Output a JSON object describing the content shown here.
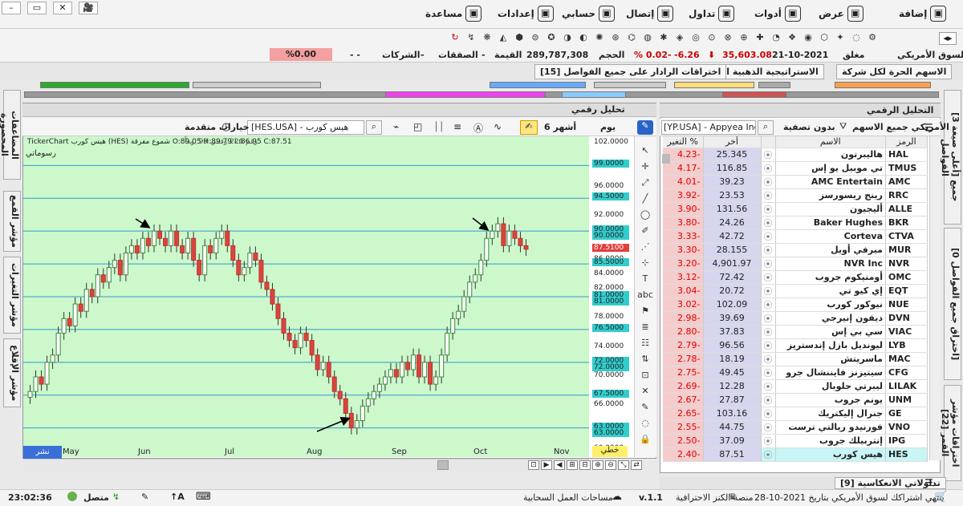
{
  "window": {
    "btns": [
      "–",
      "▭",
      "✕",
      "🎥"
    ]
  },
  "menu": [
    {
      "label": "إضافة",
      "icon": "add-icon",
      "x": 1120
    },
    {
      "label": "عرض",
      "icon": "view-icon",
      "x": 1020
    },
    {
      "label": "أدوات",
      "icon": "tools-icon",
      "x": 940
    },
    {
      "label": "تداول",
      "icon": "trade-icon",
      "x": 858
    },
    {
      "label": "إتصال",
      "icon": "connect-icon",
      "x": 780
    },
    {
      "label": "حسابي",
      "icon": "account-icon",
      "x": 700
    },
    {
      "label": "إعدادات",
      "icon": "settings-icon",
      "x": 620
    },
    {
      "label": "مساعدة",
      "icon": "help-icon",
      "x": 530
    }
  ],
  "index": {
    "market": "السوق الأمريكي",
    "status": "مغلق",
    "date": "21-10-2021",
    "value": "35,603.08",
    "change": "-6.26",
    "pct": "% 0.02-",
    "vol_label": "الحجم",
    "vol": "289,787,308",
    "val_label": "القيمة",
    "val": "-",
    "deals_label": "الصفقات",
    "deals": "-",
    "cos_label": "الشركات",
    "cos": "- -",
    "pct2": "%0.00"
  },
  "tabs1": [
    "الاسهم الحرة لكل شركة",
    "الاستراتيجية الذهبية المميزة [5]",
    "اختراقات الرادار على جميع الفواصل [15]"
  ],
  "chart": {
    "title": "تحليل رقمي",
    "search": "[HES.USA] - هيس كورب",
    "adv": "خيارات متقدمة",
    "period": "6 أشهر",
    "interval": "يوم",
    "info": "TickerChart هيس كورب (HES) شموع مفرقة O:89.05 H:89.79 L:86.95 C:87.51",
    "info2": "رقم 226 رقمي 99 يوماً",
    "draw_label": "رسوماتي",
    "months": [
      "May",
      "Jun",
      "Jul",
      "Aug",
      "Sep",
      "Oct",
      "Nov"
    ],
    "yticks": [
      "102.0000",
      "99.0000",
      "96.0000",
      "94.5000",
      "92.0000",
      "90.0000",
      "90.0000",
      "87.5100",
      "86.0000",
      "85.5000",
      "84.0000",
      "82.0000",
      "81.0000",
      "81.0000",
      "78.0000",
      "76.5000",
      "74.0000",
      "72.0000",
      "72.0000",
      "70.0000",
      "67.5000",
      "66.0000",
      "63.0000",
      "63.0000",
      "60.0000"
    ],
    "share": "نشر",
    "linear": "خطي"
  },
  "chart_data": {
    "type": "candlestick",
    "ylim": [
      59,
      103
    ],
    "last": 87.51,
    "closes": [
      68,
      70,
      69,
      72,
      73,
      76,
      78,
      77,
      80,
      79,
      82,
      81,
      84,
      83,
      85,
      86,
      84,
      87,
      88,
      87,
      89,
      88,
      90,
      89,
      88,
      90,
      88,
      87,
      89,
      86,
      84,
      88,
      87,
      89,
      90,
      88,
      86,
      84,
      85,
      87,
      86,
      83,
      82,
      80,
      78,
      76,
      75,
      74,
      76,
      75,
      73,
      71,
      72,
      70,
      68,
      67,
      65,
      63,
      64,
      66,
      67,
      68,
      69,
      70,
      71,
      70,
      72,
      71,
      73,
      70,
      72,
      69,
      70,
      73,
      76,
      78,
      79,
      81,
      83,
      84,
      86,
      89,
      90,
      91,
      88,
      90,
      89,
      88,
      87.51
    ],
    "hlines": [
      99,
      94.5,
      90,
      85.5,
      81,
      76.5,
      72,
      67.5,
      63
    ]
  },
  "watchlist": {
    "title": "التحليل الرقمي",
    "filter": "بدون تصفية",
    "market": "الأمريكي جميع الاسهم",
    "search": "[YP.USA] - Appyea Inc",
    "headers": [
      "الرمز",
      "الاسم",
      "أخر",
      "التغير %"
    ],
    "rows": [
      [
        "HAL",
        "هاليبرتون",
        "25.345",
        "4.23-"
      ],
      [
        "TMUS",
        "تي موبيل يو إس",
        "116.85",
        "4.17-"
      ],
      [
        "AMC",
        "AMC Entertain",
        "39.23",
        "4.01-"
      ],
      [
        "RRC",
        "رينج ريسورسز",
        "23.53",
        "3.92-"
      ],
      [
        "ALLE",
        "أليجيون",
        "131.56",
        "3.90-"
      ],
      [
        "BKR",
        "Baker Hughes",
        "24.26",
        "3.80-"
      ],
      [
        "CTVA",
        "Corteva",
        "42.72",
        "3.33-"
      ],
      [
        "MUR",
        "ميرفي أويل",
        "28.155",
        "3.30-"
      ],
      [
        "NVR",
        "NVR Inc",
        "4,901.97",
        "3.20-"
      ],
      [
        "OMC",
        "أومنيكوم جروب",
        "72.42",
        "3.12-"
      ],
      [
        "EQT",
        "إي كيو تي",
        "20.72",
        "3.04-"
      ],
      [
        "NUE",
        "نيوكور كورب",
        "102.09",
        "3.02-"
      ],
      [
        "DVN",
        "ديفون إنيرجي",
        "39.69",
        "2.98-"
      ],
      [
        "VIAC",
        "سي بي إس",
        "37.83",
        "2.80-"
      ],
      [
        "LYB",
        "ليونديل بازل إندستريز",
        "96.56",
        "2.79-"
      ],
      [
        "MAC",
        "ماسريتش",
        "18.19",
        "2.78-"
      ],
      [
        "CFG",
        "سيتيزنز فايننشال جرو",
        "49.45",
        "2.75-"
      ],
      [
        "LILAK",
        "ليبرتي جلوبال",
        "12.28",
        "2.69-"
      ],
      [
        "UNM",
        "يونم جروب",
        "27.87",
        "2.67-"
      ],
      [
        "GE",
        "جنرال إليكتريك",
        "103.16",
        "2.65-"
      ],
      [
        "VNO",
        "فورنيدو ريالتي ترست",
        "44.75",
        "2.55-"
      ],
      [
        "IPG",
        "إنتربيلك جروب",
        "37.09",
        "2.50-"
      ],
      [
        "HES",
        "هيس كورب",
        "87.51",
        "2.40-"
      ]
    ]
  },
  "side_left": [
    "المضاعفات المحصورة",
    "مؤشر القمع",
    "مؤشر التغيرات",
    "مؤشر الإقلاع"
  ],
  "side_right": [
    "[أعلى صيغة 3] جميع الفواصل",
    "[اختراق جميع الفواصل 0]",
    "اختراقات مؤشر القمر [22]"
  ],
  "bottomtab": "تداولاتي الانعكاسية [9]",
  "status": {
    "time": "23:02:36",
    "conn": "متصل",
    "cloud": "مساحات العمل السحابية",
    "version": "v.1.1",
    "platform": "منصة الكنز الاحترافية",
    "sub": "ينتهي اشتراكك لسوق الأمريكي بتاريخ 2021-10-28"
  }
}
